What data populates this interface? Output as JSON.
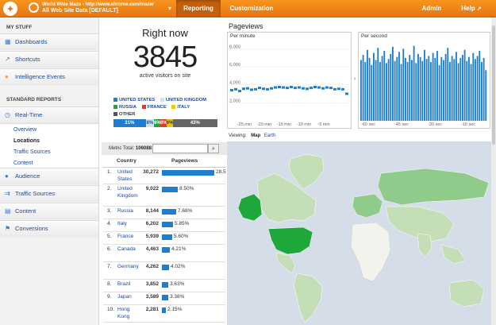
{
  "header": {
    "logo_glyph": "✦",
    "account_line1": "World Wide Maze - http://www.chrome.com/maze/",
    "account_line2": "All Web Site Data [DEFAULT]",
    "dropdown_glyph": "▾",
    "tabs": [
      {
        "label": "Reporting",
        "active": true
      },
      {
        "label": "Customization",
        "active": false
      }
    ],
    "admin_label": "Admin",
    "help_label": "Help",
    "help_glyph": "↗"
  },
  "sidebar": {
    "my_stuff_heading": "MY STUFF",
    "my_stuff_items": [
      {
        "label": "Dashboards",
        "icon": "dashboard-icon",
        "glyph": "▦"
      },
      {
        "label": "Shortcuts",
        "icon": "shortcut-icon",
        "glyph": "↗"
      },
      {
        "label": "Intelligence Events",
        "icon": "bulb-icon",
        "glyph": "●"
      }
    ],
    "standard_heading": "STANDARD REPORTS",
    "realtime": {
      "label": "Real-Time",
      "icon": "clock-icon",
      "glyph": "◷",
      "subitems": [
        {
          "label": "Overview",
          "active": false
        },
        {
          "label": "Locations",
          "active": true
        },
        {
          "label": "Traffic Sources",
          "active": false
        },
        {
          "label": "Content",
          "active": false
        }
      ]
    },
    "reports": [
      {
        "label": "Audience",
        "icon": "audience-icon",
        "glyph": "●"
      },
      {
        "label": "Traffic Sources",
        "icon": "traffic-icon",
        "glyph": "⇉"
      },
      {
        "label": "Content",
        "icon": "content-icon",
        "glyph": "▤"
      },
      {
        "label": "Conversions",
        "icon": "flag-icon",
        "glyph": "⚑"
      }
    ]
  },
  "right_now": {
    "title": "Right now",
    "count": "3845",
    "subtitle": "active visitors on site"
  },
  "legend": [
    {
      "label": "UNITED STATES",
      "color": "#1e7fd0"
    },
    {
      "label": "UNITED KINGDOM",
      "color": "#cfe3f5"
    },
    {
      "label": "RUSSIA",
      "color": "#2aa040"
    },
    {
      "label": "FRANCE",
      "color": "#e23a2a"
    },
    {
      "label": "ITALY",
      "color": "#f1c40f"
    },
    {
      "label": "OTHER",
      "color": "#555555"
    }
  ],
  "segments": [
    {
      "label": "31%",
      "share": 31,
      "color": "#1e7fd0",
      "text": "#ffffff"
    },
    {
      "label": "8%",
      "share": 8,
      "color": "#cfe3f5",
      "text": "#1a4aa0"
    },
    {
      "label": "6%",
      "share": 6,
      "color": "#2aa040",
      "text": "#ffffff"
    },
    {
      "label": "6%",
      "share": 6,
      "color": "#e23a2a",
      "text": "#ffffff"
    },
    {
      "label": "6%",
      "share": 6,
      "color": "#f1c40f",
      "text": "#333333"
    },
    {
      "label": "43%",
      "share": 43,
      "color": "#666666",
      "text": "#ffffff"
    }
  ],
  "table": {
    "metric_label": "Metric Total:",
    "metric_total": "106088",
    "search_glyph": "🔍",
    "col_country": "Country",
    "col_pageviews": "Pageviews",
    "top_label": "28.5",
    "rows": [
      {
        "idx": "1.",
        "country": "United States",
        "value": "30,272",
        "pct": "",
        "share": 28.53
      },
      {
        "idx": "2.",
        "country": "United Kingdom",
        "value": "9,022",
        "pct": "8.50%",
        "share": 8.5
      },
      {
        "idx": "3.",
        "country": "Russia",
        "value": "8,144",
        "pct": "7.68%",
        "share": 7.68
      },
      {
        "idx": "4.",
        "country": "Italy",
        "value": "6,202",
        "pct": "5.85%",
        "share": 5.85
      },
      {
        "idx": "5.",
        "country": "France",
        "value": "5,939",
        "pct": "5.60%",
        "share": 5.6
      },
      {
        "idx": "6.",
        "country": "Canada",
        "value": "4,463",
        "pct": "4.21%",
        "share": 4.21
      },
      {
        "idx": "7.",
        "country": "Germany",
        "value": "4,262",
        "pct": "4.02%",
        "share": 4.02
      },
      {
        "idx": "8.",
        "country": "Brazil",
        "value": "3,852",
        "pct": "3.63%",
        "share": 3.63
      },
      {
        "idx": "9.",
        "country": "Japan",
        "value": "3,589",
        "pct": "3.38%",
        "share": 3.38
      },
      {
        "idx": "10.",
        "country": "Hong Kong",
        "value": "2,281",
        "pct": "2.15%",
        "share": 2.15
      }
    ]
  },
  "pageviews": {
    "title": "Pageviews",
    "per_minute_label": "Per minute",
    "per_second_label": "Per second",
    "y_ticks": [
      "8,000",
      "6,000",
      "4,000",
      "2,000"
    ],
    "minute_ticks": [
      "-25 min",
      "-20 min",
      "-15 min",
      "-10 min",
      "-5 min"
    ],
    "second_ticks": [
      "-60 sec",
      "-45 sec",
      "-30 sec",
      "-15 sec"
    ],
    "per_minute_values": [
      3400,
      3500,
      3300,
      3550,
      3600,
      3450,
      3500,
      3650,
      3550,
      3500,
      3600,
      3700,
      3750,
      3700,
      3650,
      3750,
      3650,
      3700,
      3600,
      3550,
      3650,
      3750,
      3700,
      3600,
      3700,
      3650,
      3500,
      3550,
      3500,
      3000
    ],
    "per_second_values": [
      60,
      65,
      58,
      70,
      62,
      55,
      67,
      60,
      72,
      58,
      64,
      69,
      57,
      61,
      66,
      73,
      59,
      63,
      68,
      56,
      71,
      62,
      58,
      65,
      60,
      74,
      57,
      66,
      63,
      59,
      70,
      61,
      64,
      58,
      67,
      62,
      69,
      55,
      63,
      60,
      66,
      72,
      58,
      64,
      61,
      68,
      57,
      62,
      65,
      70,
      59,
      63,
      56,
      67,
      61,
      64,
      69,
      58,
      62,
      50
    ],
    "arrow_glyph": "›"
  },
  "map_view": {
    "viewing_label": "Viewing:",
    "map_label": "Map",
    "earth_label": "Earth",
    "colors": {
      "high": "#1ea73a",
      "mid": "#8fcb8a",
      "low": "#c4deb7",
      "ocean": "#d4dde8",
      "none": "#f3f3ee"
    }
  }
}
